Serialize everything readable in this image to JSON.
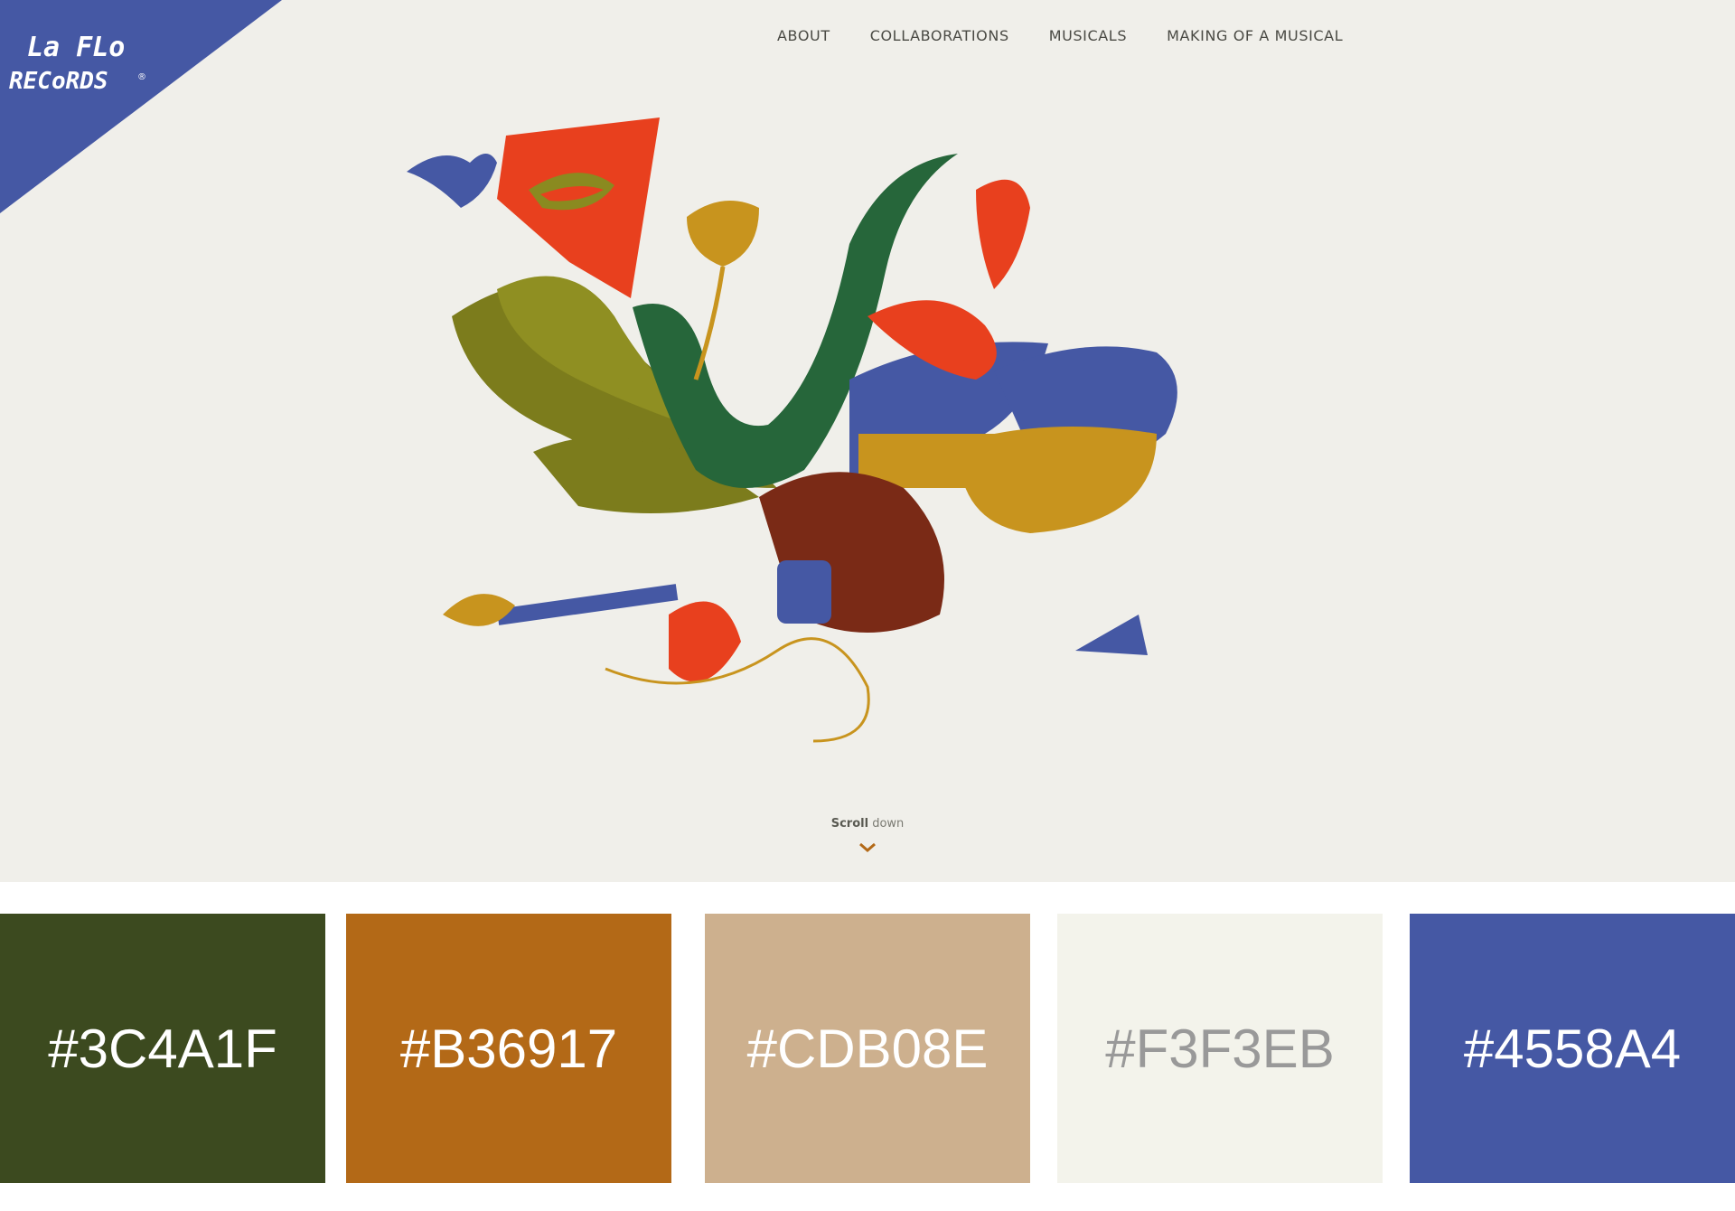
{
  "brand": {
    "logo_alt": "La Flo Records",
    "logo_line1": "La FLo",
    "logo_line2": "RECoRDS",
    "trademark": "®",
    "corner_color": "#4558A4"
  },
  "nav": {
    "items": [
      {
        "label": "ABOUT"
      },
      {
        "label": "COLLABORATIONS"
      },
      {
        "label": "MUSICALS"
      },
      {
        "label": "MAKING OF A MUSICAL"
      }
    ]
  },
  "hero": {
    "background": "#F0EFEA",
    "illustration": "musical-instruments-illustration",
    "scroll_bold": "Scroll",
    "scroll_rest": "down",
    "scroll_icon": "chevron-down-icon",
    "accent": "#B36917"
  },
  "palette": [
    {
      "hex": "#3C4A1F",
      "text_color": "#ffffff"
    },
    {
      "hex": "#B36917",
      "text_color": "#ffffff"
    },
    {
      "hex": "#CDB08E",
      "text_color": "#ffffff"
    },
    {
      "hex": "#F3F3EB",
      "text_color": "#999999"
    },
    {
      "hex": "#4558A4",
      "text_color": "#ffffff"
    }
  ]
}
